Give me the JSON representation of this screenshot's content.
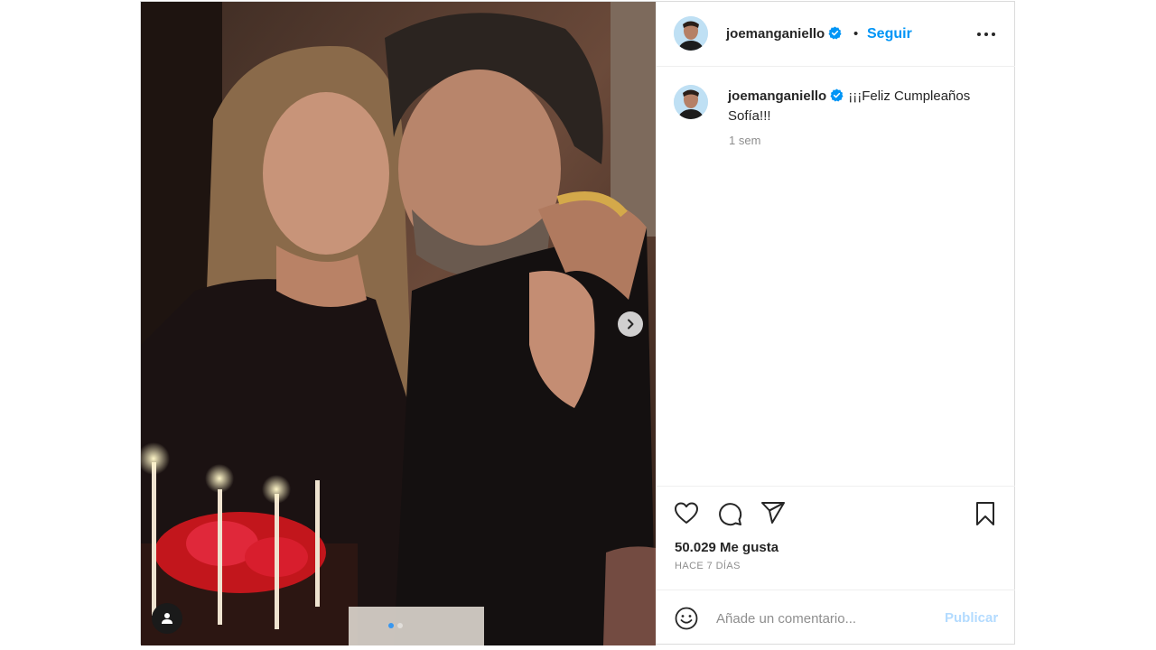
{
  "post": {
    "username": "joemanganiello",
    "follow_label": "Seguir",
    "separator": "•",
    "caption": "¡¡¡Feliz Cumpleaños Sofía!!!",
    "caption_time": "1 sem",
    "likes": "50.029 Me gusta",
    "date": "HACE 7 DÍAS",
    "comment_placeholder": "Añade un comentario...",
    "publish_label": "Publicar",
    "carousel": {
      "total": 2,
      "current": 1
    },
    "colors": {
      "link_blue": "#0095f6",
      "publish_disabled": "#b3dbff",
      "verified_blue": "#0095f6",
      "muted": "#8e8e8e",
      "text": "#262626"
    },
    "icons": {
      "next": "chevron-right-icon",
      "user_tag": "user-icon",
      "verified": "verified-badge-icon",
      "more": "more-horizontal-icon",
      "like": "heart-icon",
      "comment": "comment-icon",
      "share": "send-icon",
      "save": "bookmark-icon",
      "emoji": "emoji-icon"
    }
  }
}
